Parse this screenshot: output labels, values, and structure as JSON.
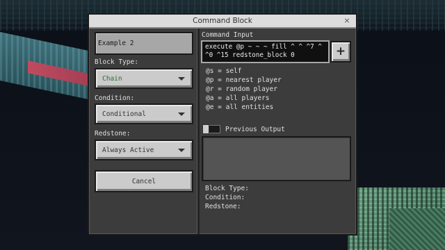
{
  "dialog": {
    "title": "Command Block",
    "close_glyph": "×"
  },
  "left": {
    "name_value": "Example 2",
    "block_type_label": "Block Type:",
    "block_type_value": "Chain",
    "condition_label": "Condition:",
    "condition_value": "Conditional",
    "redstone_label": "Redstone:",
    "redstone_value": "Always Active",
    "cancel_label": "Cancel"
  },
  "right": {
    "command_input_label": "Command Input",
    "command_text": "execute @p ~ ~ ~ fill ^ ^ ^7 ^\n^0 ^15 redstone_block 0",
    "plus_glyph": "+",
    "selectors": [
      "@s = self",
      "@p = nearest player",
      "@r = random player",
      "@a = all players",
      "@e = all entities"
    ],
    "previous_output_label": "Previous Output",
    "info_block_type": "Block Type:",
    "info_condition": "Condition:",
    "info_redstone": "Redstone:"
  },
  "colors": {
    "chain_text": "#2e6b2e",
    "dialog_bg": "#3c3c3c",
    "title_bar": "#dcdcdc"
  },
  "icons": {
    "close": "close-icon",
    "add": "plus-icon",
    "dropdown": "chevron-down-icon"
  }
}
